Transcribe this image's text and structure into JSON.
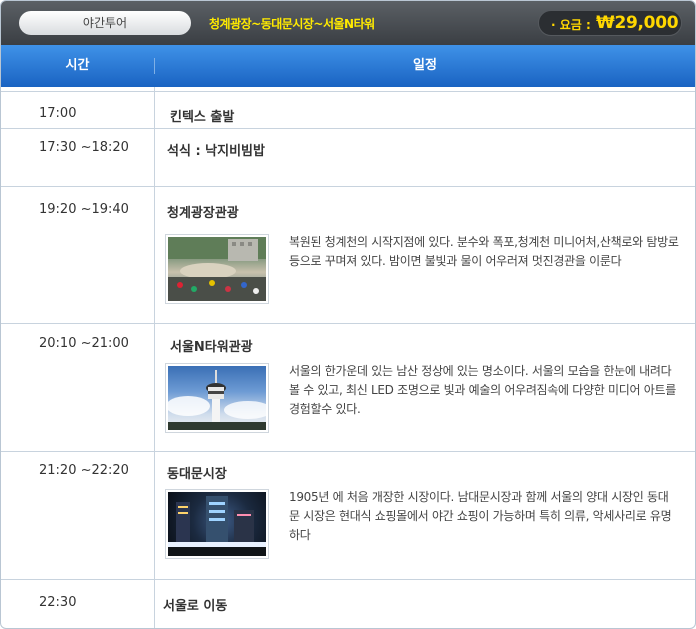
{
  "header": {
    "tour_type": "야간투어",
    "route": "청계광장~동대문시장~서울N타워",
    "price_label": "· 요금 :",
    "price_value": "₩29,000"
  },
  "table": {
    "col_time": "시간",
    "col_schedule": "일정"
  },
  "rows": [
    {
      "time": "17:00",
      "title": "킨텍스 출발"
    },
    {
      "time": "17:30 ~18:20",
      "title": "석식 : 낙지비빔밥"
    },
    {
      "time": "19:20 ~19:40",
      "title": "청계광장관광",
      "desc": "복원된 청계천의 시작지점에 있다. 분수와 폭포,청계천 미니어처,산책로와 탐방로 등으로 꾸며져 있다. 밤이면 불빛과 물이 어우러져 멋진경관을 이룬다"
    },
    {
      "time": "20:10 ~21:00",
      "title": "서울N타워관광",
      "desc": "서울의 한가운데 있는 남산 정상에 있는 명소이다. 서울의 모습을 한눈에 내려다 볼 수 있고, 최신 LED 조명으로 빛과 예술의 어우려짐속에 다양한 미디어 아트를 경험할수 있다."
    },
    {
      "time": "21:20 ~22:20",
      "title": "동대문시장",
      "desc": "1905년 에 처음 개장한 시장이다. 남대문시장과 함께 서울의 양대 시장인 동대문 시장은 현대식 쇼핑몰에서 야간 쇼핑이 가능하며 특히 의류, 악세사리로 유명하다"
    },
    {
      "time": "22:30",
      "title": "서울로 이동"
    }
  ],
  "colors": {
    "header_bg": "#3a3e43",
    "route_text": "#ffea00",
    "price_text": "#ffd700",
    "table_head": "#2a78d8",
    "border": "#c8d3de"
  }
}
